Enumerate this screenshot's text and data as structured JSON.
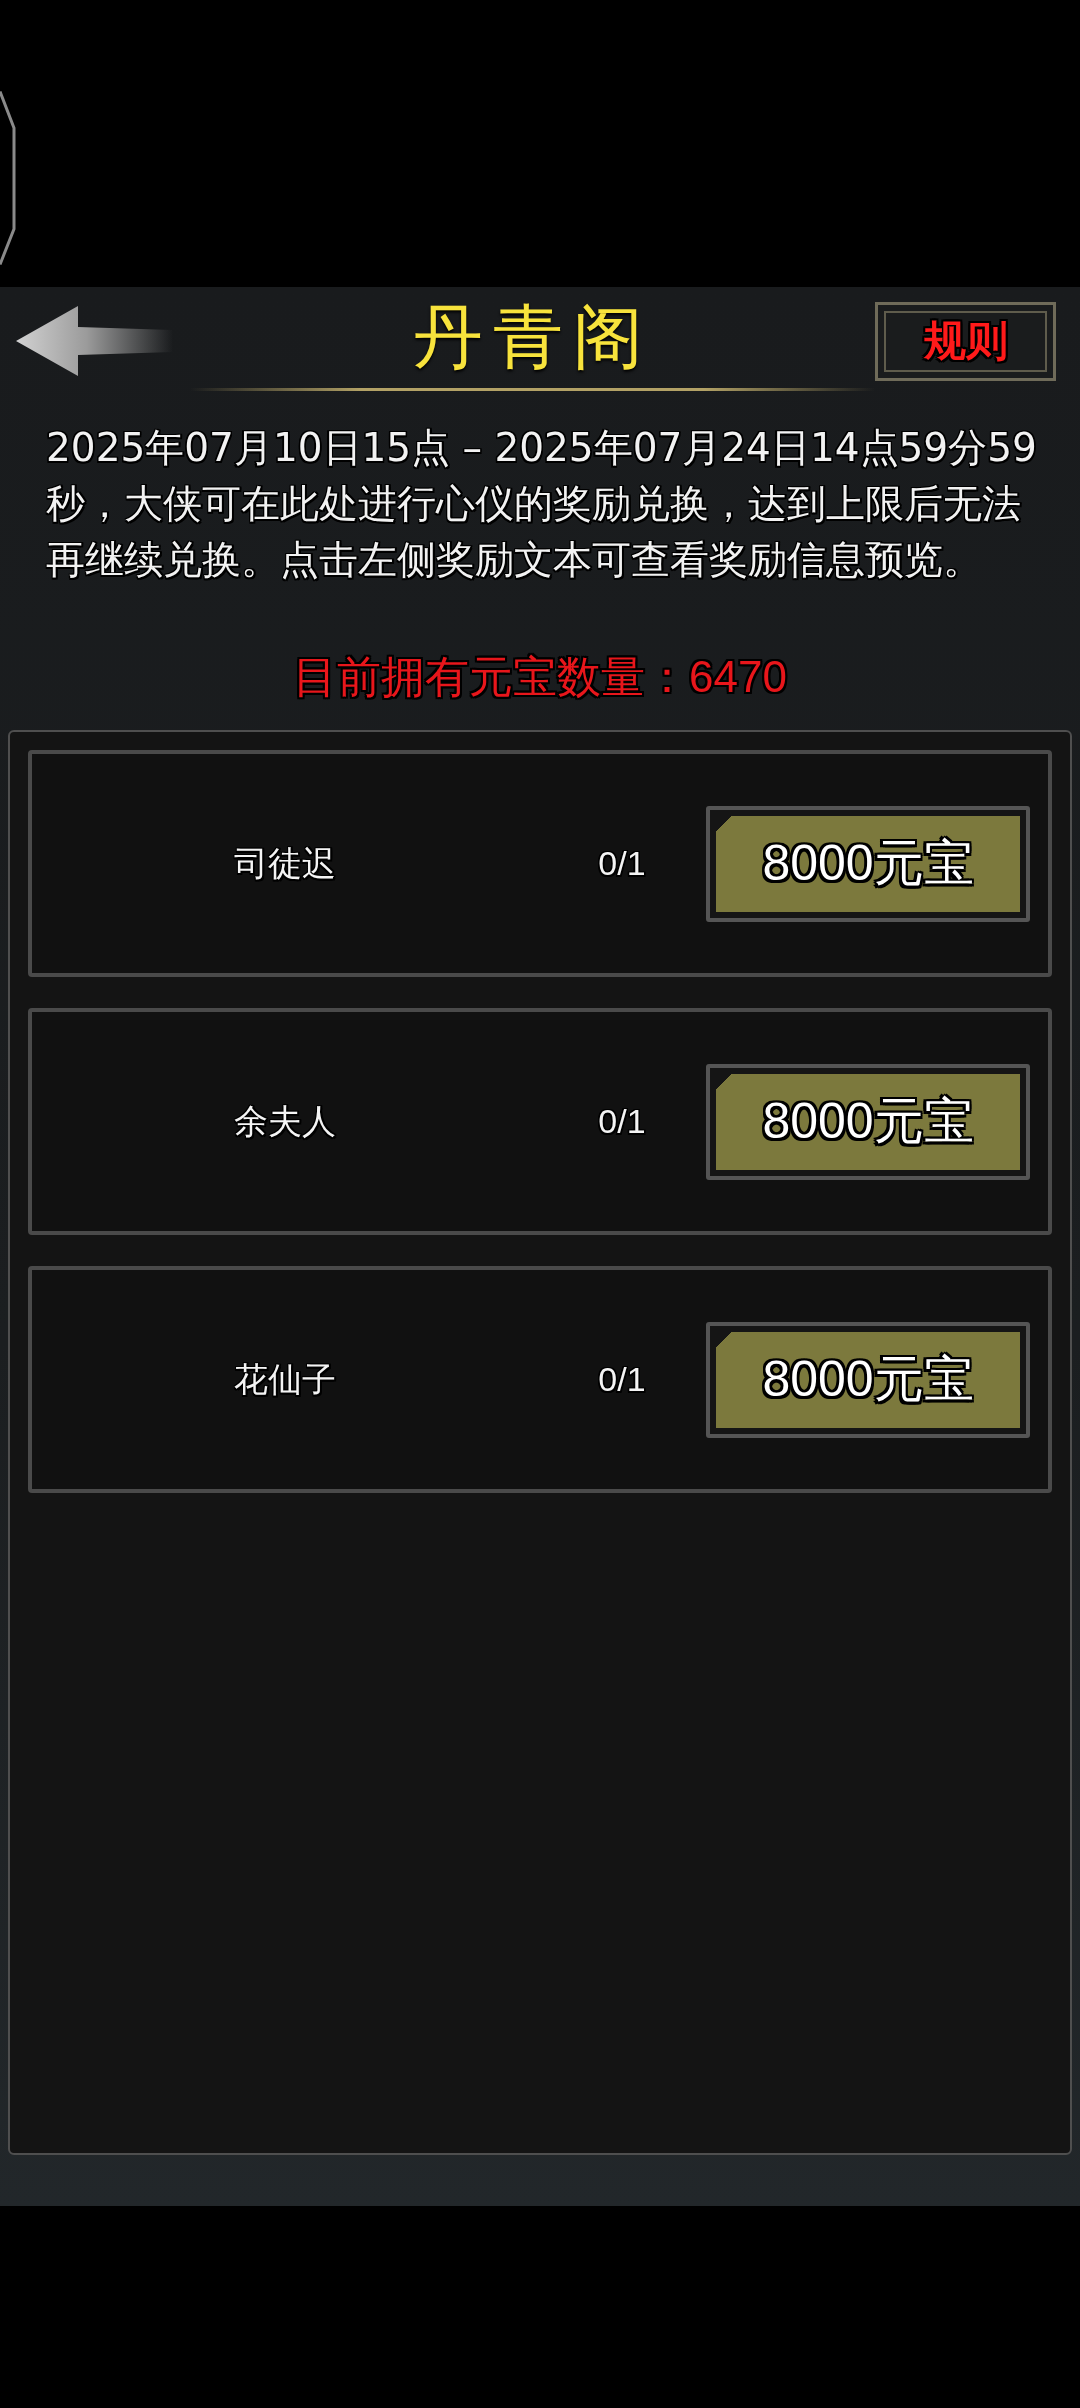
{
  "header": {
    "title": "丹青阁",
    "rules_label": "规则"
  },
  "description": "2025年07月10日15点 – 2025年07月24日14点59分59秒，大侠可在此处进行心仪的奖励兑换，达到上限后无法再继续兑换。点击左侧奖励文本可查看奖励信息预览。",
  "balance": "目前拥有元宝数量：6470",
  "rewards": [
    {
      "name": "司徒迟",
      "count": "0/1",
      "price": "8000元宝"
    },
    {
      "name": "余夫人",
      "count": "0/1",
      "price": "8000元宝"
    },
    {
      "name": "花仙子",
      "count": "0/1",
      "price": "8000元宝"
    }
  ]
}
